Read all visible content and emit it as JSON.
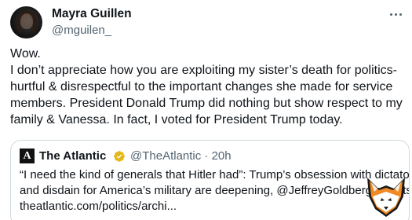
{
  "author": {
    "name": "Mayra Guillen",
    "handle": "@mguilen_"
  },
  "tweet": {
    "lines": [
      "Wow.",
      "I don’t appreciate how you are exploiting my sister’s death for politics-",
      "hurtful & disrespectful to the important changes she made for service",
      "members. President Donald Trump did nothing but show respect to my",
      "family & Vanessa. In fact, I voted for President Trump today."
    ]
  },
  "quoted": {
    "logo_letter": "A",
    "name": "The Atlantic",
    "handle_time": "@TheAtlantic · 20h",
    "lines": [
      "“I need the kind of generals that Hitler had”: Trump’s obsession with dictators",
      "and disdain for America’s military are deepening, @JeffreyGoldberg reports:",
      "theatlantic.com/politics/archi..."
    ]
  },
  "colors": {
    "text": "#0f1419",
    "secondary": "#536471",
    "border": "#cfd9de",
    "verified_gold": "#e2b719"
  },
  "icons": {
    "more": "more-icon",
    "verified": "verified-badge-icon",
    "watermark": "fox-logo-icon"
  }
}
